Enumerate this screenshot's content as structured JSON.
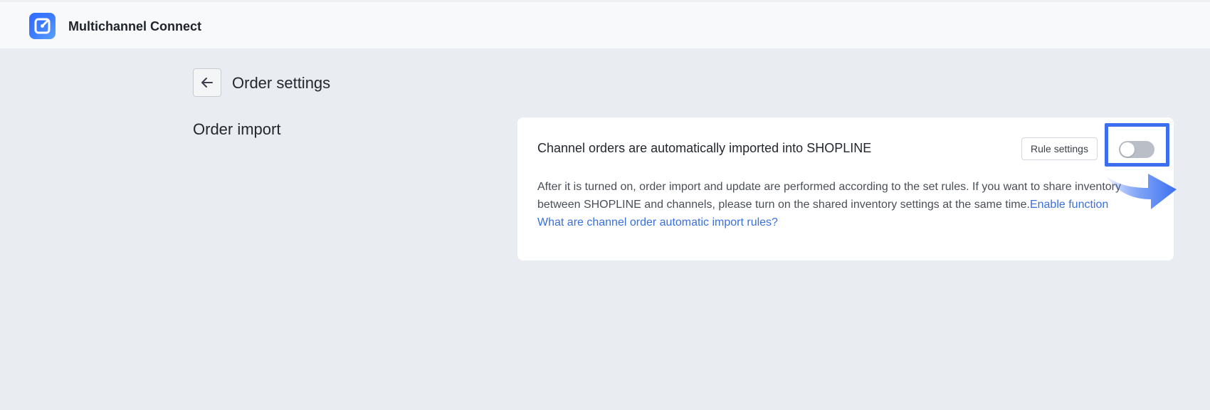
{
  "header": {
    "app_name": "Multichannel Connect",
    "logo_icon": "app-logo-icon"
  },
  "page": {
    "title": "Order settings",
    "back_icon": "arrow-left-icon"
  },
  "section": {
    "title": "Order import"
  },
  "card": {
    "heading": "Channel orders are automatically imported into SHOPLINE",
    "rule_button_label": "Rule settings",
    "toggle": {
      "state": "off"
    },
    "description": "After it is turned on, order import and update are performed according to the set rules. If you want to share inventory between SHOPLINE and channels, please turn on the shared inventory settings at the same time.",
    "enable_link": "Enable function",
    "rules_link": "What are channel order automatic import rules?"
  },
  "colors": {
    "accent": "#3a6fe0",
    "highlight": "#3b6ff0",
    "background": "#e9ecf0"
  }
}
